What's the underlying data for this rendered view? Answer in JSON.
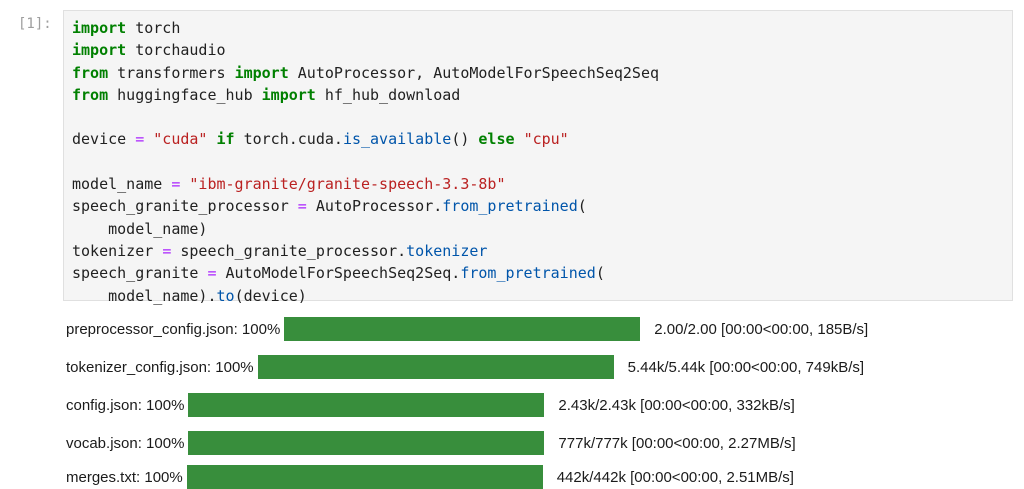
{
  "cell": {
    "prompt": "[1]:"
  },
  "code": {
    "l1": [
      "import",
      " torch"
    ],
    "l2": [
      "import",
      " torchaudio"
    ],
    "l3": [
      "from",
      " transformers ",
      "import",
      " AutoProcessor, AutoModelForSpeechSeq2Seq"
    ],
    "l4": [
      "from",
      " huggingface_hub ",
      "import",
      " hf_hub_download"
    ],
    "l6": [
      "device ",
      "=",
      " ",
      "\"cuda\"",
      " ",
      "if",
      " torch.cuda.",
      "is_available",
      "() ",
      "else",
      " ",
      "\"cpu\""
    ],
    "l8": [
      "model_name ",
      "=",
      " ",
      "\"ibm-granite/granite-speech-3.3-8b\""
    ],
    "l9": [
      "speech_granite_processor ",
      "=",
      " AutoProcessor.",
      "from_pretrained",
      "("
    ],
    "l10": [
      "    model_name)"
    ],
    "l11": [
      "tokenizer ",
      "=",
      " speech_granite_processor.",
      "tokenizer"
    ],
    "l12": [
      "speech_granite ",
      "=",
      " AutoModelForSpeechSeq2Seq.",
      "from_pretrained",
      "("
    ],
    "l13": [
      "    model_name).",
      "to",
      "(device)"
    ]
  },
  "progress_bars": [
    {
      "desc": "preprocessor_config.json:  100%",
      "progress": 1.0,
      "stats": "2.00/2.00  [00:00<00:00,  185B/s]"
    },
    {
      "desc": "tokenizer_config.json:  100%",
      "progress": 1.0,
      "stats": "5.44k/5.44k  [00:00<00:00,  749kB/s]"
    },
    {
      "desc": "config.json:  100%",
      "progress": 1.0,
      "stats": "2.43k/2.43k  [00:00<00:00,  332kB/s]"
    },
    {
      "desc": "vocab.json:  100%",
      "progress": 1.0,
      "stats": "777k/777k  [00:00<00:00,  2.27MB/s]"
    },
    {
      "desc": "merges.txt:  100%",
      "progress": 1.0,
      "stats": "442k/442k  [00:00<00:00,  2.51MB/s]"
    }
  ],
  "colors": {
    "bar_fill": "#388e3c",
    "keyword": "#008000",
    "string": "#ba2121",
    "operator": "#aa22ff",
    "function": "#0055aa"
  }
}
